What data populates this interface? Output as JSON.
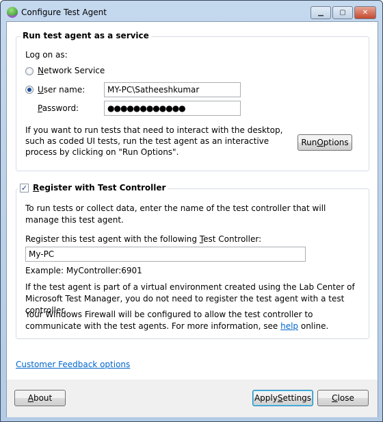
{
  "window": {
    "title": "Configure Test Agent",
    "minimize": "▁",
    "maximize": "▢",
    "close": "✕"
  },
  "service": {
    "legend": "Run test agent as a service",
    "logon_label": "Log on as:",
    "network_service": {
      "key": "N",
      "rest": "etwork Service",
      "selected": false
    },
    "user_name": {
      "key": "U",
      "rest": "ser name:",
      "selected": true,
      "value": "MY-PC\\Satheeshkumar"
    },
    "password": {
      "key": "P",
      "rest": "assword:",
      "value": "●●●●●●●●●●●●"
    },
    "info": "If you want to run tests that need to interact with the desktop, such as coded UI tests, run the test agent as an interactive process by clicking on \"Run Options\".",
    "run_options": {
      "pre": "Run ",
      "key": "O",
      "rest": "ptions"
    }
  },
  "controller": {
    "checkbox": {
      "key": "R",
      "rest": "egister with Test Controller",
      "checked": true
    },
    "intro": "To run tests or collect data, enter the name of the test controller that will manage this test agent.",
    "field_label": {
      "pre": "Register this test agent with the following ",
      "key": "T",
      "rest": "est Controller:"
    },
    "value": "My-PC",
    "example": "Example: MyController:6901",
    "virtual_note": "If the test agent is part of a virtual environment created using the Lab Center of Microsoft Test Manager, you do not need to register the test agent with a test controller.",
    "firewall_pre": "Your Windows Firewall will be configured to allow the test controller to communicate with the test agents. For more information, see ",
    "firewall_link": "help",
    "firewall_post": " online."
  },
  "feedback_link": "Customer Feedback options",
  "buttons": {
    "about": {
      "key": "A",
      "rest": "bout"
    },
    "apply": {
      "pre": "Apply ",
      "key": "S",
      "rest": "ettings"
    },
    "close": {
      "key": "C",
      "rest": "lose"
    }
  }
}
